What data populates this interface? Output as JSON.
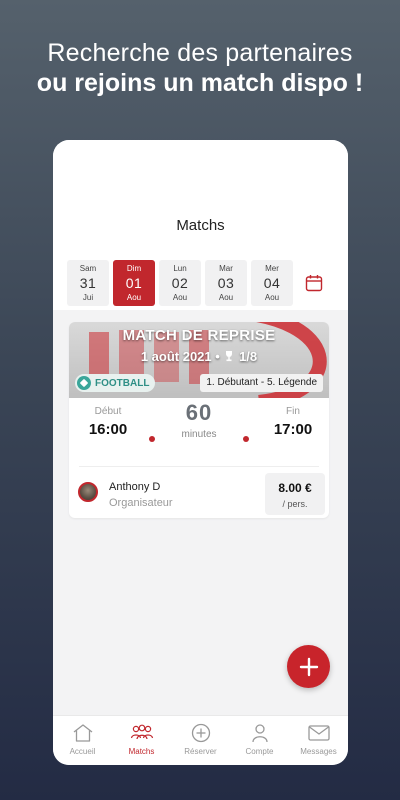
{
  "headline": {
    "line1": "Recherche des partenaires",
    "line2": "ou rejoins un match dispo !"
  },
  "header": {
    "title": "Matchs"
  },
  "dates": [
    {
      "name": "Sam",
      "num": "31",
      "month": "Jui",
      "active": false
    },
    {
      "name": "Dim",
      "num": "01",
      "month": "Aou",
      "active": true
    },
    {
      "name": "Lun",
      "num": "02",
      "month": "Aou",
      "active": false
    },
    {
      "name": "Mar",
      "num": "03",
      "month": "Aou",
      "active": false
    },
    {
      "name": "Mer",
      "num": "04",
      "month": "Aou",
      "active": false
    }
  ],
  "match": {
    "title": "MATCH DE REPRISE",
    "date": "1 août 2021",
    "players": "1/8",
    "sport": "FOOTBALL",
    "level": "1. Débutant - 5. Légende",
    "start_label": "Début",
    "start": "16:00",
    "end_label": "Fin",
    "end": "17:00",
    "duration": "60",
    "duration_unit": "minutes",
    "organizer_name": "Anthony D",
    "organizer_role": "Organisateur",
    "price": "8.00 €",
    "price_unit": "/ pers."
  },
  "tabs": [
    {
      "label": "Accueil",
      "icon": "home-icon",
      "active": false
    },
    {
      "label": "Matchs",
      "icon": "players-icon",
      "active": true
    },
    {
      "label": "Réserver",
      "icon": "plus-circle-icon",
      "active": false
    },
    {
      "label": "Compte",
      "icon": "user-icon",
      "active": false
    },
    {
      "label": "Messages",
      "icon": "mail-icon",
      "active": false
    }
  ],
  "colors": {
    "accent": "#c1272d",
    "sport": "#3aa69a",
    "background_top": "#55616c",
    "background_bottom": "#232b44"
  }
}
